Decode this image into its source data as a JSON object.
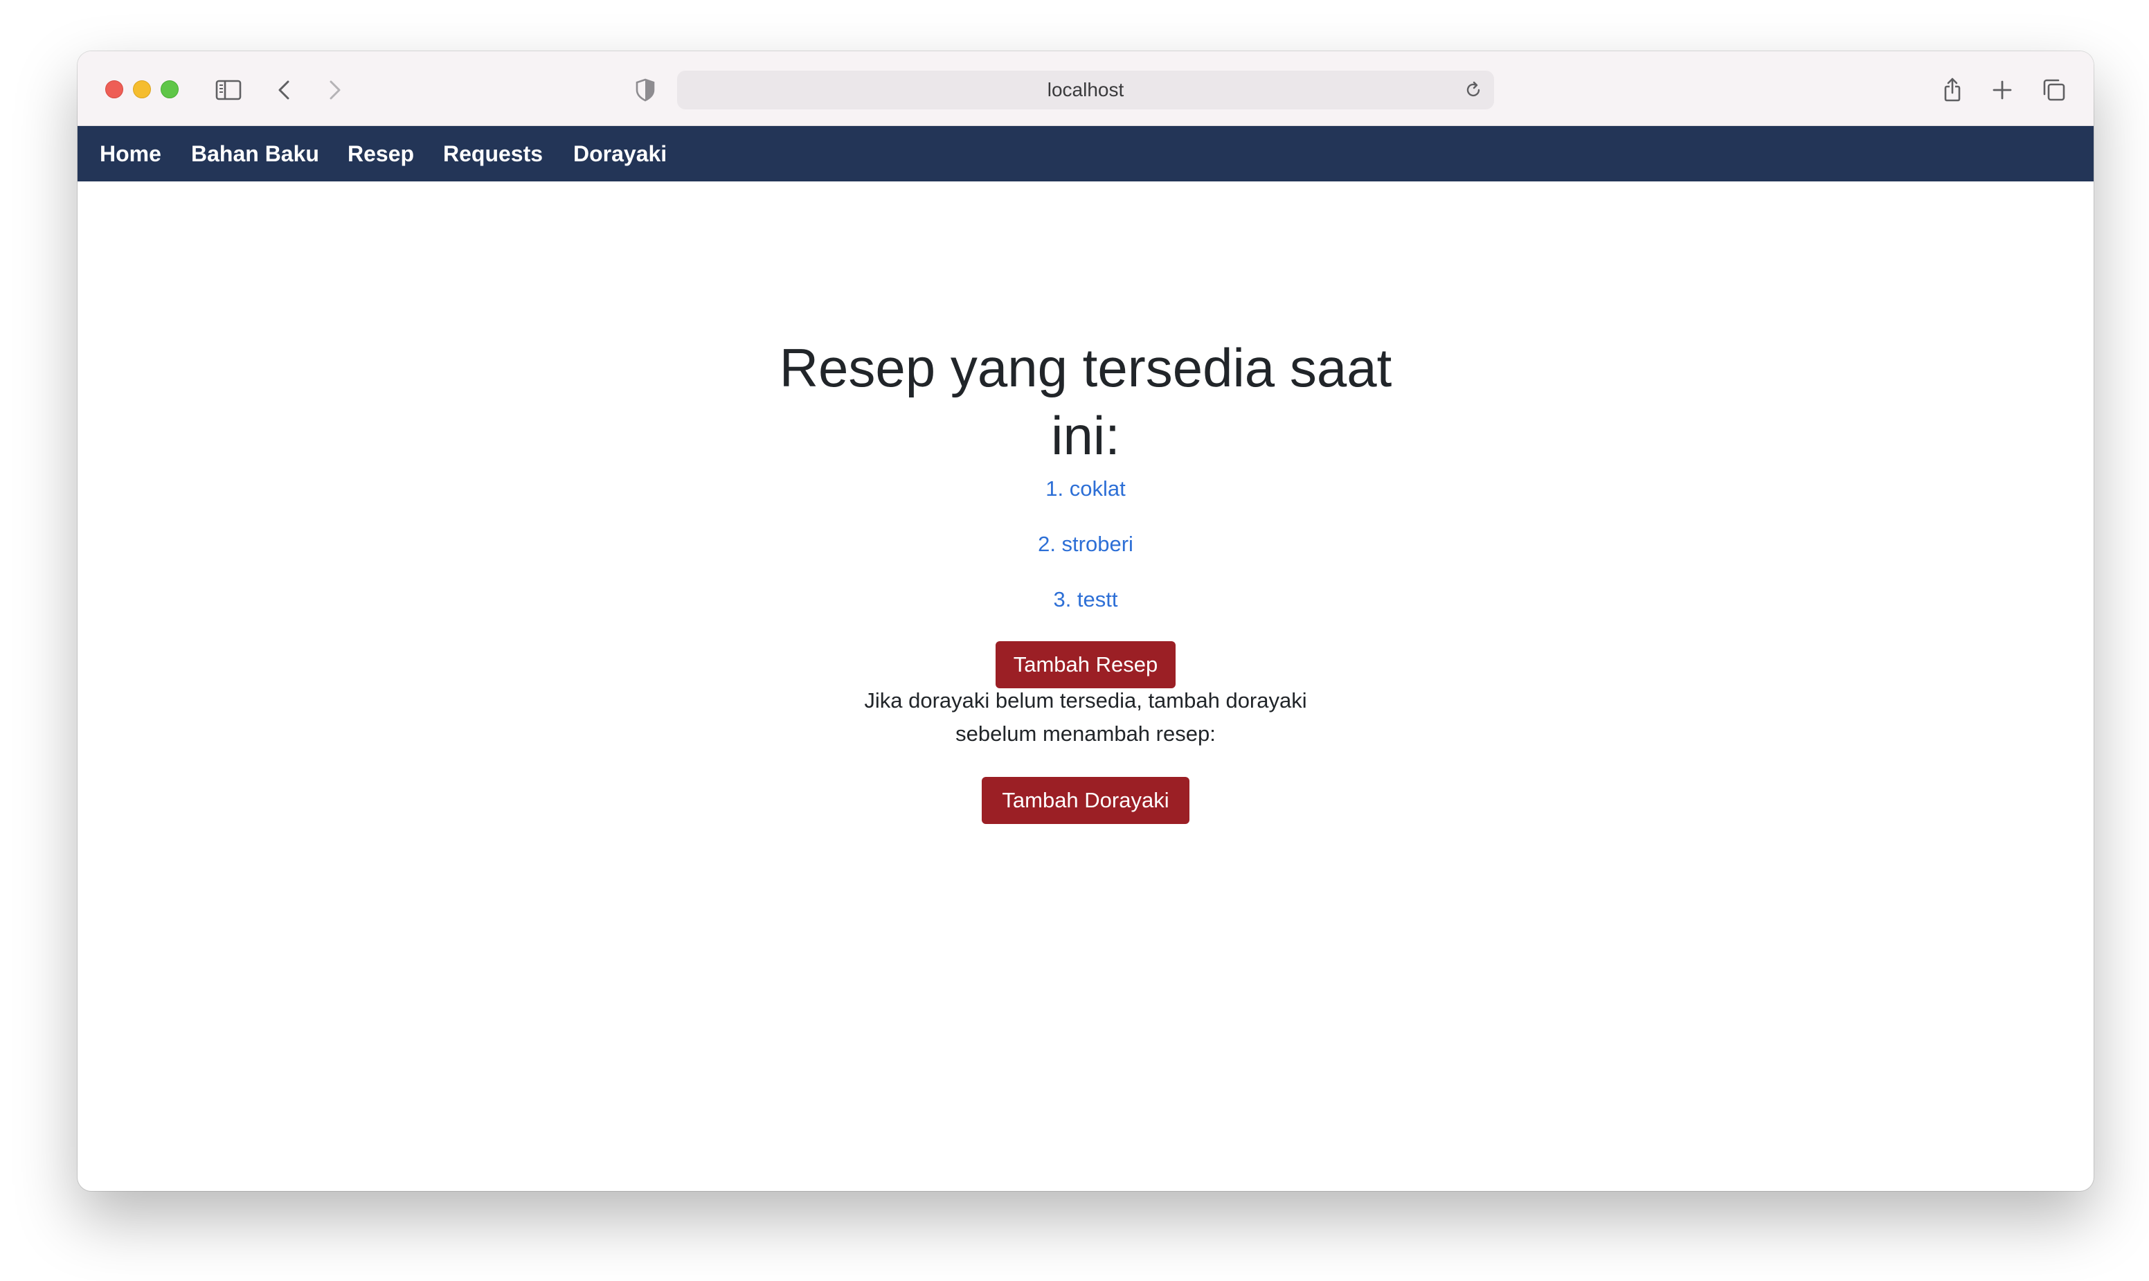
{
  "browser": {
    "address": "localhost"
  },
  "nav": {
    "items": [
      {
        "label": "Home"
      },
      {
        "label": "Bahan Baku"
      },
      {
        "label": "Resep"
      },
      {
        "label": "Requests"
      },
      {
        "label": "Dorayaki"
      }
    ]
  },
  "main": {
    "title": "Resep yang tersedia saat ini:",
    "recipes": [
      {
        "label": "1. coklat"
      },
      {
        "label": "2. stroberi"
      },
      {
        "label": "3. testt"
      }
    ],
    "add_recipe_button": "Tambah Resep",
    "note": "Jika dorayaki belum tersedia, tambah dorayaki sebelum menambah resep:",
    "add_dorayaki_button": "Tambah Dorayaki"
  },
  "colors": {
    "navbar": "#233557",
    "link": "#2d6fd6",
    "button": "#9b1f25"
  }
}
